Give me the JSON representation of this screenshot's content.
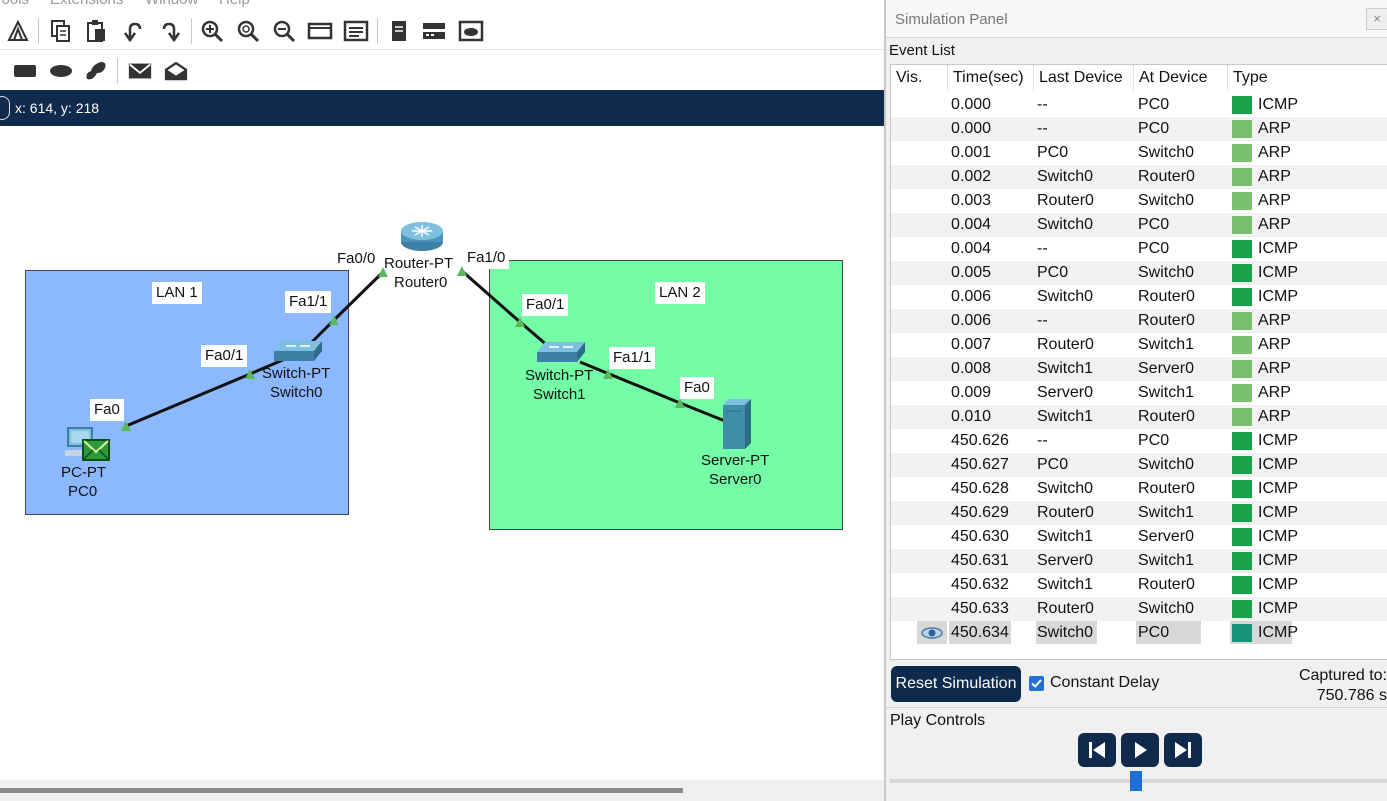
{
  "menu": {
    "items": [
      "Tools",
      "Extensions",
      "Window",
      "Help"
    ]
  },
  "toolbar": {
    "row1_icons": [
      "navigator-icon",
      "copy-icon",
      "paste-icon",
      "undo-icon",
      "redo-icon",
      "zoom-in-icon",
      "zoom-reset-icon",
      "zoom-out-icon",
      "drawing-palette-icon",
      "custom-device-dialog-icon",
      "notes-icon",
      "network-device-icon",
      "cloud-icon"
    ],
    "row2_icons": [
      "rectangle-icon",
      "ellipse-icon",
      "freeform-icon",
      "simple-pdu-icon",
      "complex-pdu-icon"
    ]
  },
  "coordinates": "x: 614, y: 218",
  "topology": {
    "areas": [
      {
        "label": "LAN 1",
        "color": "#8bb8ff"
      },
      {
        "label": "LAN 2",
        "color": "#75fca6"
      }
    ],
    "devices": {
      "router": {
        "type": "Router-PT",
        "name": "Router0"
      },
      "switch0": {
        "type": "Switch-PT",
        "name": "Switch0"
      },
      "switch1": {
        "type": "Switch-PT",
        "name": "Switch1"
      },
      "pc0": {
        "type": "PC-PT",
        "name": "PC0"
      },
      "server0": {
        "type": "Server-PT",
        "name": "Server0"
      }
    },
    "ports": {
      "router_left": "Fa0/0",
      "router_right": "Fa1/0",
      "switch0_up": "Fa1/1",
      "switch0_down": "Fa0/1",
      "pc0": "Fa0",
      "switch1_up": "Fa0/1",
      "switch1_down": "Fa1/1",
      "server0": "Fa0"
    }
  },
  "panel": {
    "title": "Simulation Panel",
    "close": "×",
    "event_list_title": "Event List",
    "columns": [
      "Vis.",
      "Time(sec)",
      "Last Device",
      "At Device",
      "Type"
    ],
    "events": [
      {
        "time": "0.000",
        "last": "--",
        "at": "PC0",
        "type": "ICMP",
        "color": "#1aa34a"
      },
      {
        "time": "0.000",
        "last": "--",
        "at": "PC0",
        "type": "ARP",
        "color": "#79bd6e"
      },
      {
        "time": "0.001",
        "last": "PC0",
        "at": "Switch0",
        "type": "ARP",
        "color": "#79bd6e"
      },
      {
        "time": "0.002",
        "last": "Switch0",
        "at": "Router0",
        "type": "ARP",
        "color": "#79bd6e"
      },
      {
        "time": "0.003",
        "last": "Router0",
        "at": "Switch0",
        "type": "ARP",
        "color": "#79bd6e"
      },
      {
        "time": "0.004",
        "last": "Switch0",
        "at": "PC0",
        "type": "ARP",
        "color": "#79bd6e"
      },
      {
        "time": "0.004",
        "last": "--",
        "at": "PC0",
        "type": "ICMP",
        "color": "#1aa34a"
      },
      {
        "time": "0.005",
        "last": "PC0",
        "at": "Switch0",
        "type": "ICMP",
        "color": "#1aa34a"
      },
      {
        "time": "0.006",
        "last": "Switch0",
        "at": "Router0",
        "type": "ICMP",
        "color": "#1aa34a"
      },
      {
        "time": "0.006",
        "last": "--",
        "at": "Router0",
        "type": "ARP",
        "color": "#79bd6e"
      },
      {
        "time": "0.007",
        "last": "Router0",
        "at": "Switch1",
        "type": "ARP",
        "color": "#79bd6e"
      },
      {
        "time": "0.008",
        "last": "Switch1",
        "at": "Server0",
        "type": "ARP",
        "color": "#79bd6e"
      },
      {
        "time": "0.009",
        "last": "Server0",
        "at": "Switch1",
        "type": "ARP",
        "color": "#79bd6e"
      },
      {
        "time": "0.010",
        "last": "Switch1",
        "at": "Router0",
        "type": "ARP",
        "color": "#79bd6e"
      },
      {
        "time": "450.626",
        "last": "--",
        "at": "PC0",
        "type": "ICMP",
        "color": "#1aa34a"
      },
      {
        "time": "450.627",
        "last": "PC0",
        "at": "Switch0",
        "type": "ICMP",
        "color": "#1aa34a"
      },
      {
        "time": "450.628",
        "last": "Switch0",
        "at": "Router0",
        "type": "ICMP",
        "color": "#1aa34a"
      },
      {
        "time": "450.629",
        "last": "Router0",
        "at": "Switch1",
        "type": "ICMP",
        "color": "#1aa34a"
      },
      {
        "time": "450.630",
        "last": "Switch1",
        "at": "Server0",
        "type": "ICMP",
        "color": "#1aa34a"
      },
      {
        "time": "450.631",
        "last": "Server0",
        "at": "Switch1",
        "type": "ICMP",
        "color": "#1aa34a"
      },
      {
        "time": "450.632",
        "last": "Switch1",
        "at": "Router0",
        "type": "ICMP",
        "color": "#1aa34a"
      },
      {
        "time": "450.633",
        "last": "Router0",
        "at": "Switch0",
        "type": "ICMP",
        "color": "#1aa34a"
      },
      {
        "time": "450.634",
        "last": "Switch0",
        "at": "PC0",
        "type": "ICMP",
        "color": "#16947a",
        "selected": true,
        "visible_icon": "eye-icon"
      }
    ],
    "reset_label": "Reset Simulation",
    "constant_delay_label": "Constant Delay",
    "constant_delay_checked": true,
    "captured_label": "Captured to:",
    "captured_value": "750.786 s",
    "play_controls_label": "Play Controls",
    "play_buttons": [
      "back-icon",
      "play-icon",
      "forward-icon"
    ]
  }
}
